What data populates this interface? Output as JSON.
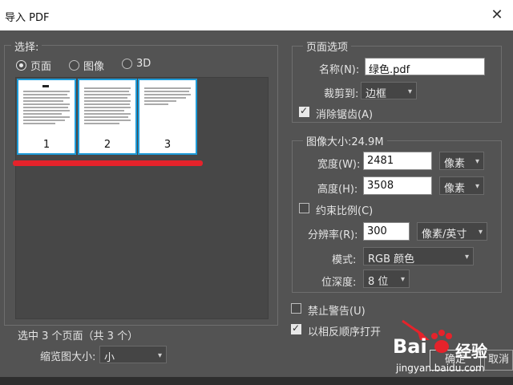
{
  "window": {
    "title": "导入 PDF",
    "close_glyph": "✕"
  },
  "left": {
    "select_legend": "选择:",
    "radios": [
      {
        "label": "页面",
        "checked": true
      },
      {
        "label": "图像",
        "checked": false
      },
      {
        "label": "3D",
        "checked": false
      }
    ],
    "thumbnails": [
      "1",
      "2",
      "3"
    ],
    "selection_status": "选中 3 个页面（共 3 个）",
    "thumb_size_label": "缩览图大小:",
    "thumb_size_value": "小"
  },
  "page_options": {
    "legend": "页面选项",
    "name_label": "名称(N):",
    "name_value": "绿色.pdf",
    "crop_label": "裁剪到:",
    "crop_value": "边框",
    "antialias_label": "消除锯齿(A)",
    "antialias_checked": true
  },
  "image_size": {
    "legend": "图像大小:24.9M",
    "width_label": "宽度(W):",
    "width_value": "2481",
    "width_unit": "像素",
    "height_label": "高度(H):",
    "height_value": "3508",
    "height_unit": "像素",
    "constrain_label": "约束比例(C)",
    "constrain_checked": false,
    "resolution_label": "分辨率(R):",
    "resolution_value": "300",
    "resolution_unit": "像素/英寸",
    "mode_label": "模式:",
    "mode_value": "RGB 颜色",
    "depth_label": "位深度:",
    "depth_value": "8 位"
  },
  "options": {
    "suppress_warnings_label": "禁止警告(U)",
    "suppress_warnings_checked": false,
    "reverse_order_label": "以相反顺序打开",
    "reverse_order_checked": true
  },
  "buttons": {
    "ok": "确定",
    "cancel": "取消"
  },
  "watermark": {
    "brand": "Bai",
    "brand2": "经验",
    "url": "jingyan.baidu.com"
  },
  "colors": {
    "accent_blue": "#1e9bd8",
    "red_mark": "#e5232b",
    "background": "#535353"
  }
}
